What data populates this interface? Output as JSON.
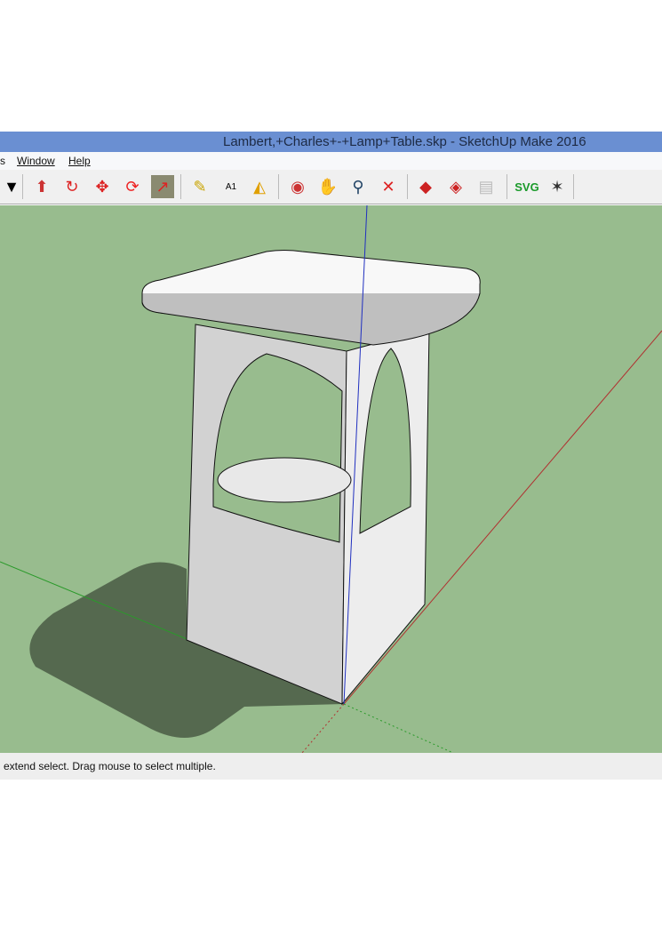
{
  "window": {
    "title": "Lambert,+Charles+-+Lamp+Table.skp - SketchUp Make 2016"
  },
  "menu": {
    "items": [
      "s",
      "Window",
      "Help"
    ]
  },
  "toolbar": {
    "svg_label": "SVG",
    "icons": [
      "dropdown",
      "push-pull",
      "follow-me",
      "move",
      "rotate",
      "scale",
      "tape-measure",
      "text",
      "paint-bucket",
      "orbit",
      "pan",
      "zoom",
      "zoom-extents",
      "warehouse",
      "extension-warehouse",
      "share-model",
      "svg-export",
      "mosquito"
    ]
  },
  "status": {
    "text": "extend select. Drag mouse to select multiple."
  },
  "colors": {
    "titlebar": "#6a8fd2",
    "ground": "#98bc8e",
    "shadow": "#55694f"
  }
}
